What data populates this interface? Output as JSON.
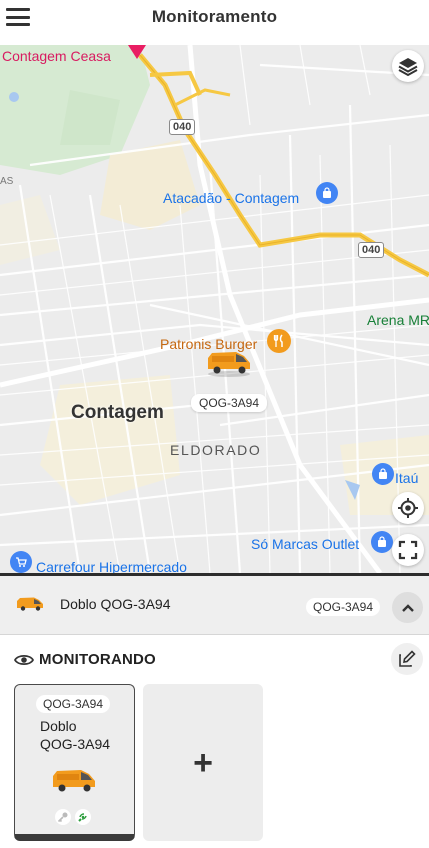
{
  "header": {
    "title": "Monitoramento",
    "menu_icon": "hamburger-menu-icon"
  },
  "map": {
    "places": {
      "ceasa": "Contagem Ceasa",
      "atacadao": "Atacadão - Contagem",
      "arena": "Arena MR",
      "patronis": "Patronis Burger",
      "city": "Contagem",
      "district": "ELDORADO",
      "itau": "Itaú",
      "somarcas": "Só Marcas Outlet",
      "carrefour": "Carrefour Hipermercado",
      "edge": "AS"
    },
    "highway_shields": [
      "040",
      "040"
    ],
    "vehicle_plate": "QOG-3A94",
    "controls": {
      "layers": "layers-icon",
      "locate": "crosshair-icon",
      "fullscreen": "fullscreen-icon"
    }
  },
  "vehicle_bar": {
    "name": "Doblo QOG-3A94",
    "plate": "QOG-3A94"
  },
  "monitoring": {
    "title": "MONITORANDO",
    "cards": [
      {
        "plate": "QOG-3A94",
        "name": "Doblo\nQOG-3A94"
      }
    ],
    "add_label": "+"
  },
  "colors": {
    "van": "#f29b1d",
    "poi_blue": "#4285f4",
    "highway": "#f6c843",
    "status_green": "#2e9e3e"
  }
}
